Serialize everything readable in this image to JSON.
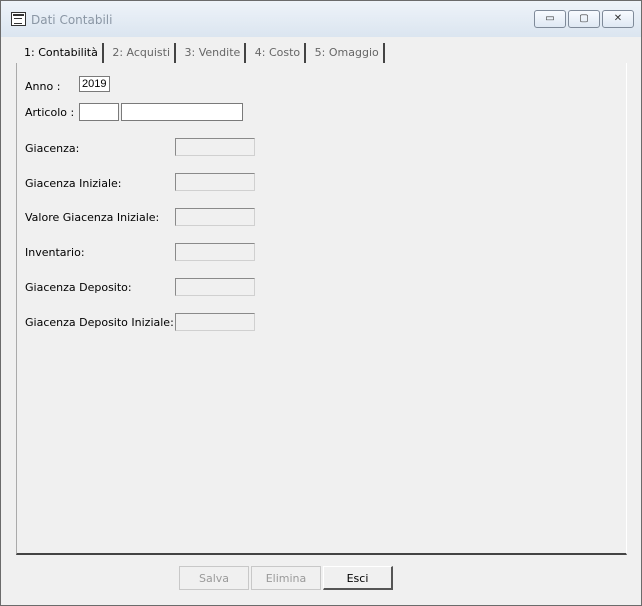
{
  "window": {
    "title": "Dati Contabili"
  },
  "titlebar": {
    "minimize": "▭",
    "maximize": "▢",
    "close": "✕"
  },
  "tabs": [
    {
      "label": "1: Contabilità",
      "active": true
    },
    {
      "label": "2: Acquisti",
      "active": false
    },
    {
      "label": "3: Vendite",
      "active": false
    },
    {
      "label": "4: Costo",
      "active": false
    },
    {
      "label": "5: Omaggio",
      "active": false
    }
  ],
  "form": {
    "anno_label": "Anno :",
    "anno_value": "2019",
    "articolo_label": "Articolo :",
    "articolo_code": "",
    "articolo_desc": "",
    "fields": [
      {
        "label": "Giacenza:",
        "value": ""
      },
      {
        "label": "Giacenza Iniziale:",
        "value": ""
      },
      {
        "label": "Valore Giacenza Iniziale:",
        "value": ""
      },
      {
        "label": "Inventario:",
        "value": ""
      },
      {
        "label": "Giacenza Deposito:",
        "value": ""
      },
      {
        "label": "Giacenza Deposito Iniziale:",
        "value": ""
      }
    ]
  },
  "buttons": {
    "salva": "Salva",
    "elimina": "Elimina",
    "esci": "Esci"
  }
}
